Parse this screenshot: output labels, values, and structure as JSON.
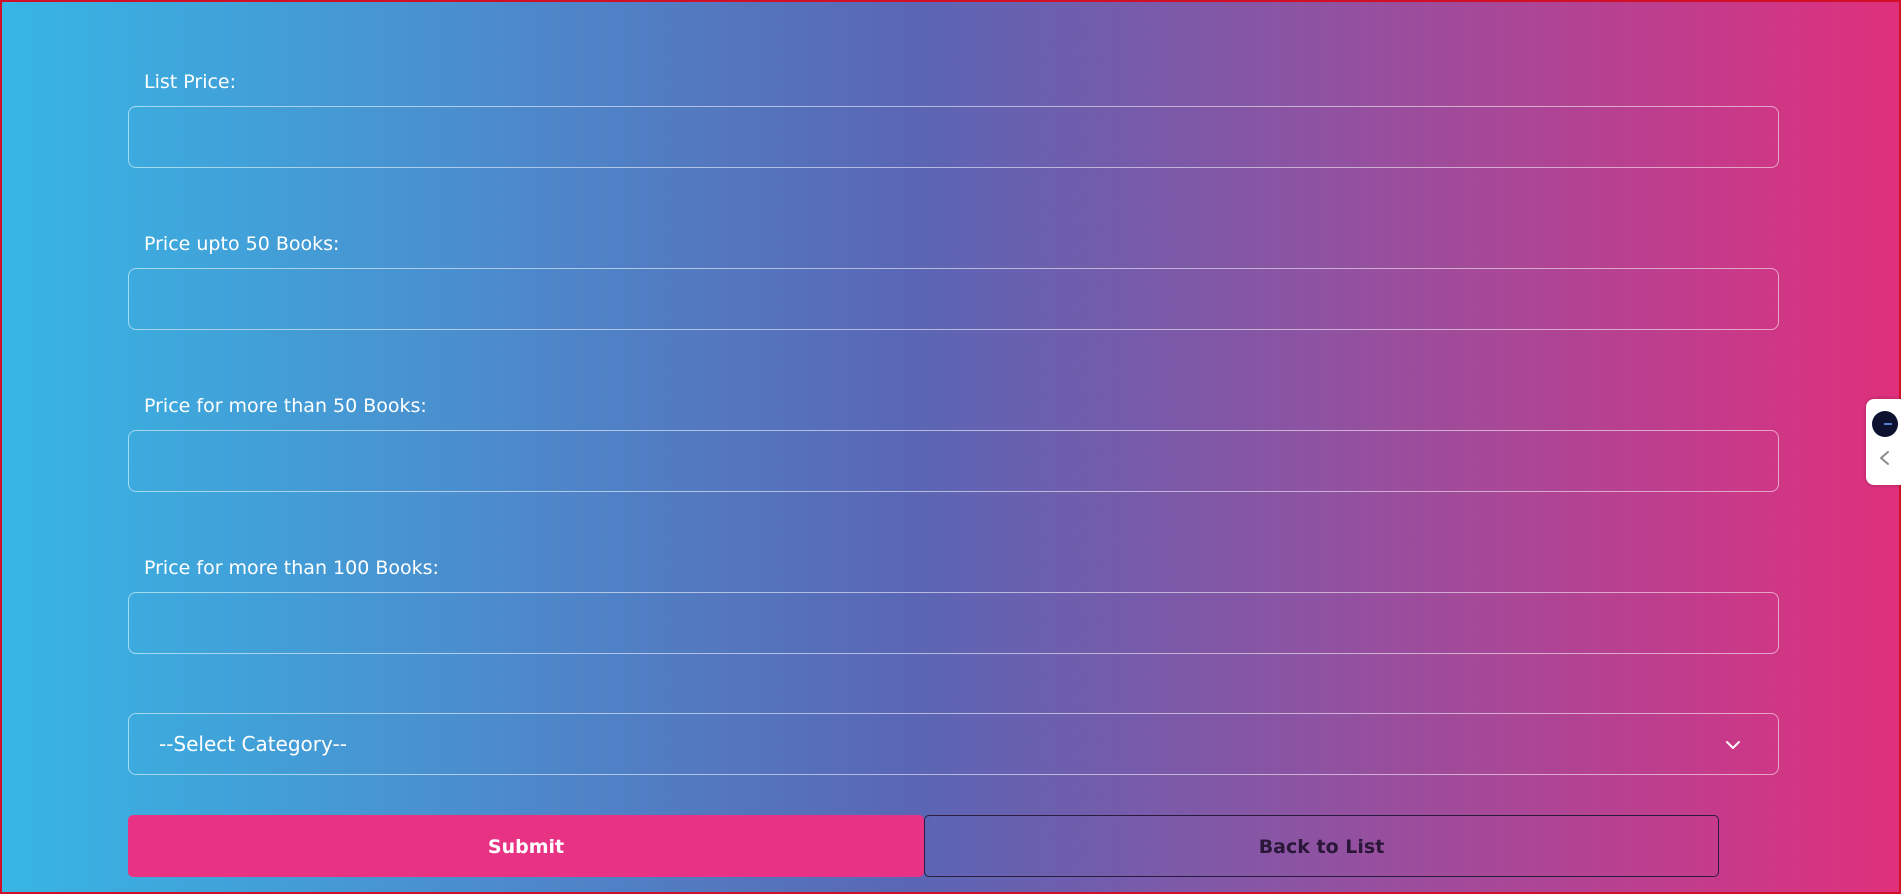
{
  "form": {
    "fields": [
      {
        "label": "List Price:",
        "value": ""
      },
      {
        "label": "Price upto 50 Books:",
        "value": ""
      },
      {
        "label": "Price for more than 50 Books:",
        "value": ""
      },
      {
        "label": "Price for more than 100 Books:",
        "value": ""
      }
    ],
    "category_select": {
      "selected": "--Select Category--"
    },
    "submit_label": "Submit",
    "back_label": "Back to List"
  },
  "colors": {
    "gradient_start": "#37b6e5",
    "gradient_mid": "#5a66b5",
    "gradient_end": "#e0307c",
    "submit_bg": "#e83283",
    "frame_border": "#d10f26"
  },
  "icons": {
    "select_chevron": "chevron-down-icon",
    "widget_avatar": "assistant-avatar-icon",
    "widget_toggle": "chevron-left-icon"
  }
}
